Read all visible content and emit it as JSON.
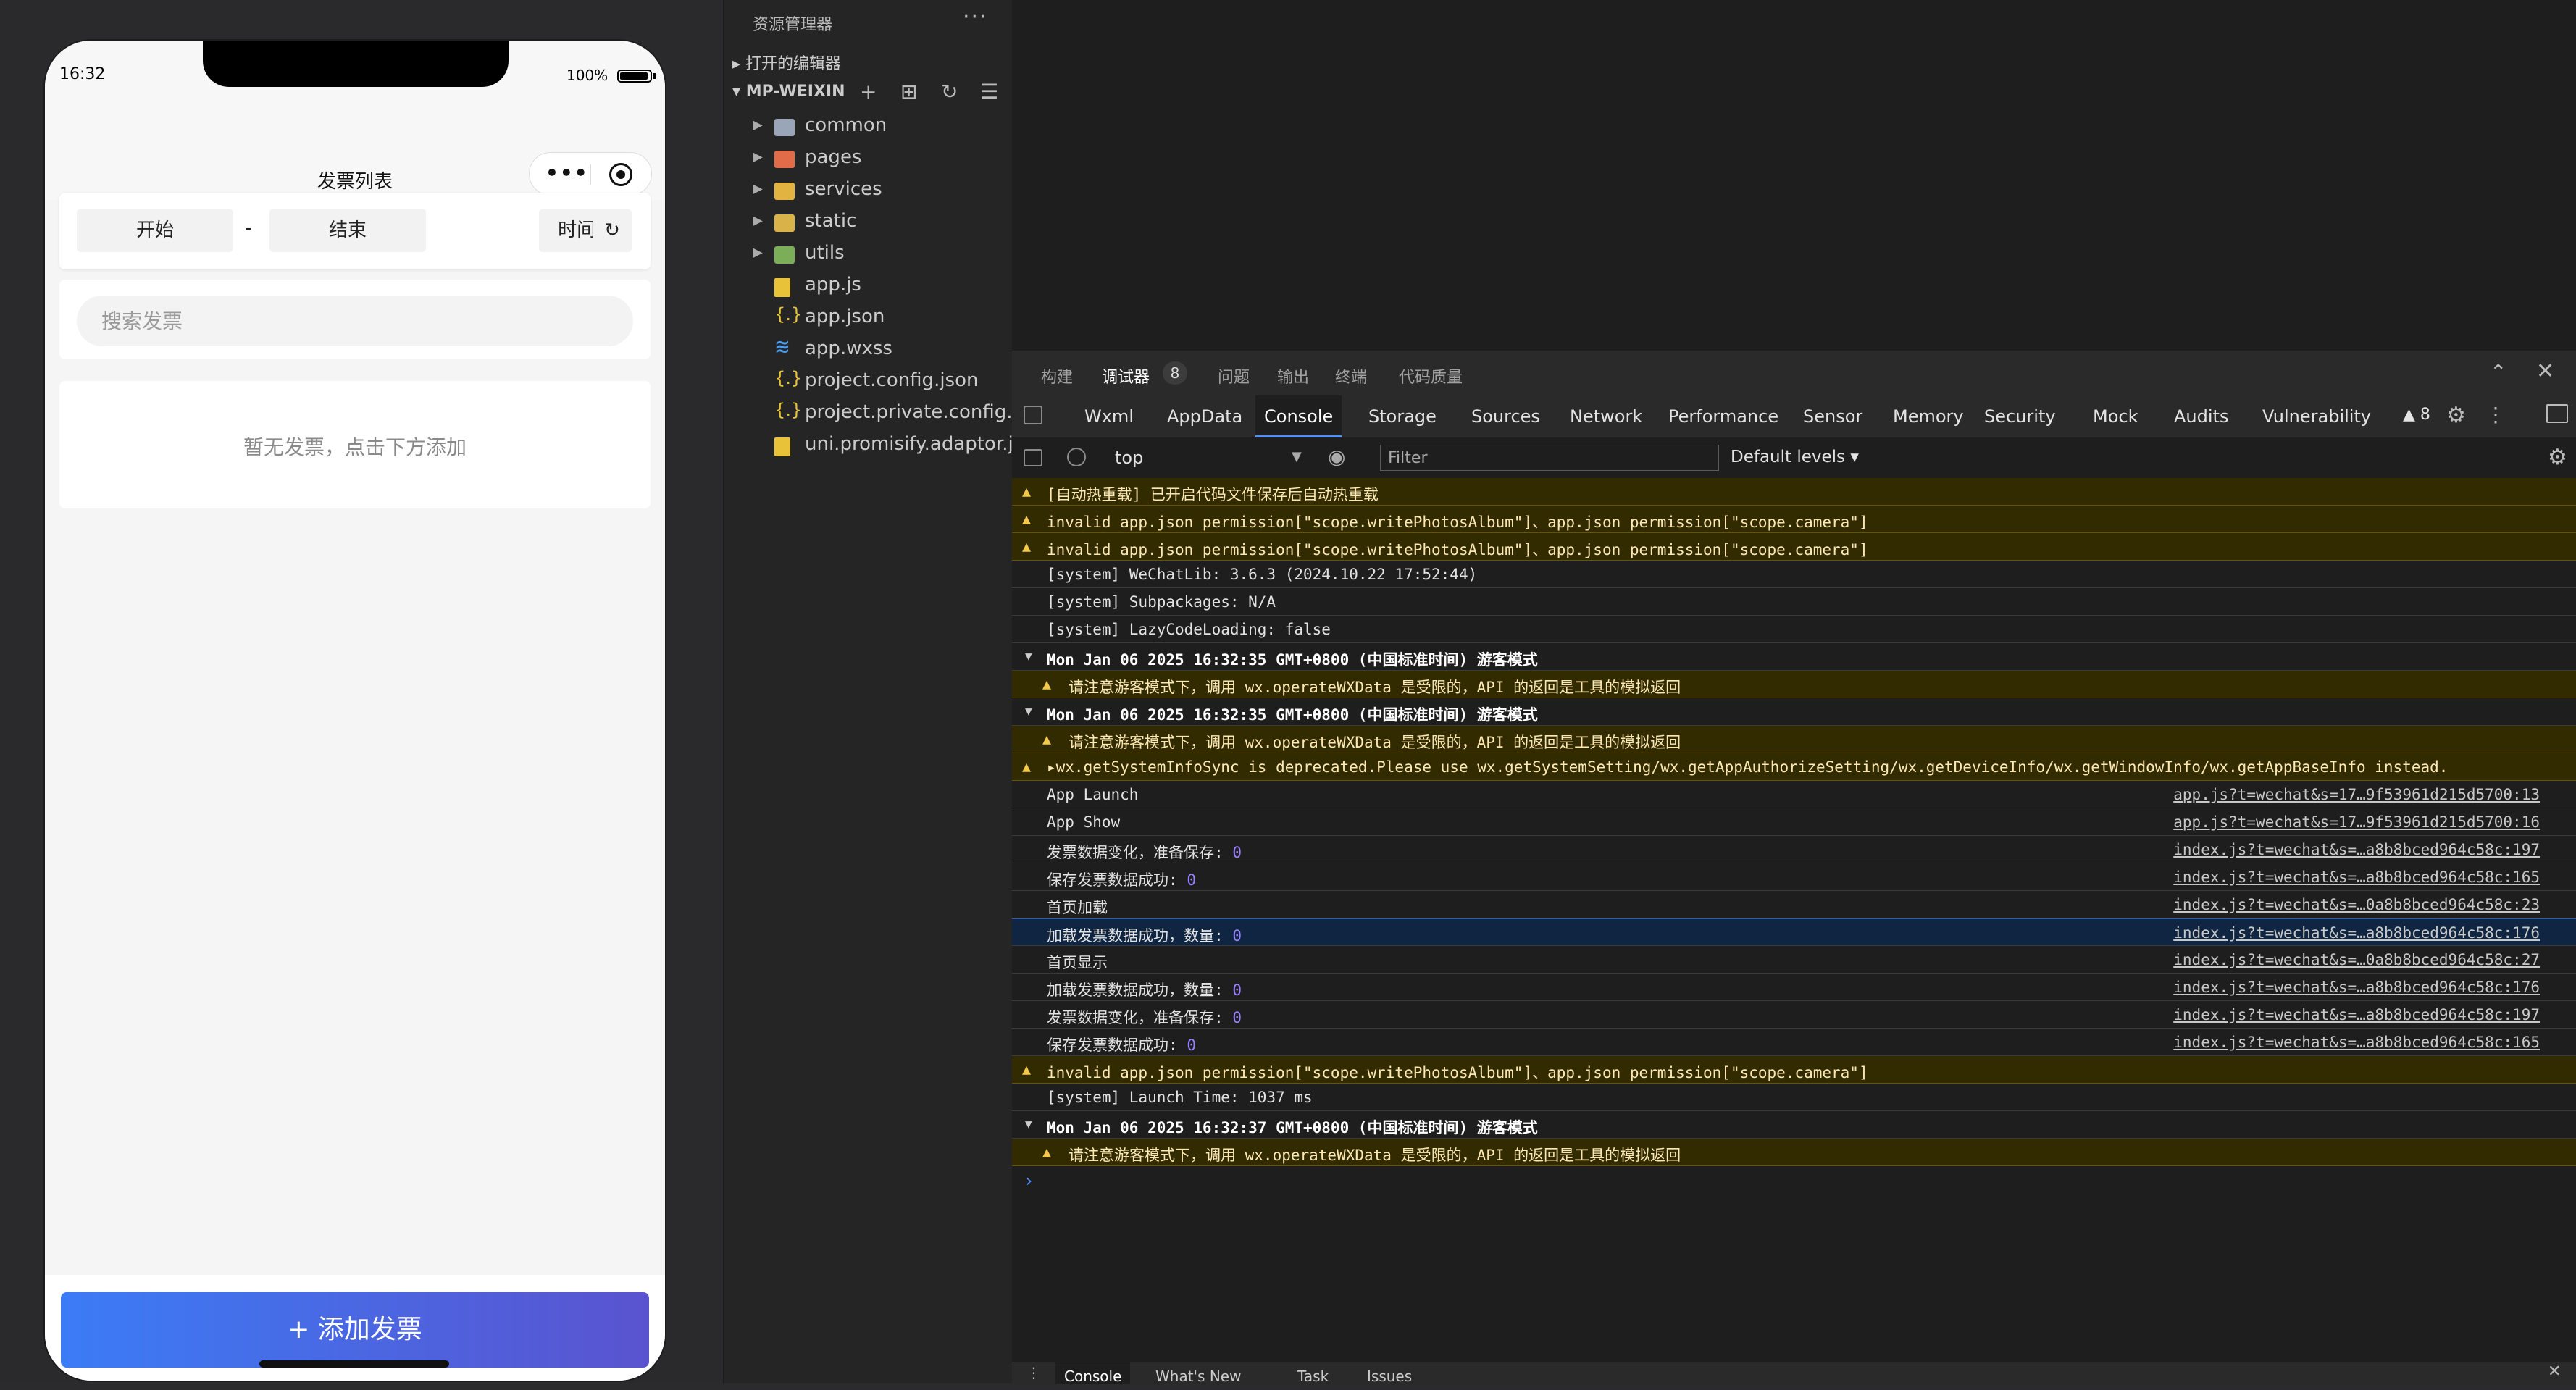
{
  "phone": {
    "status_time": "16:32",
    "battery_text": "100%",
    "nav_title": "发票列表",
    "capsule_more": "•••",
    "start_label": "开始",
    "date_separator": "-",
    "end_label": "结束",
    "sort_label": "时间↓",
    "reset_label": "↻",
    "search_placeholder": "搜索发票",
    "empty_text": "暂无发票，点击下方添加",
    "add_button": "+ 添加发票"
  },
  "explorer": {
    "title": "资源管理器",
    "more": "···",
    "open_editors": "▸ 打开的编辑器",
    "project": "▾ MP-WEIXIN",
    "tools": [
      "+",
      "⊞",
      "↻",
      "☰"
    ],
    "items": [
      {
        "label": "common",
        "type": "folder",
        "icon": "folder-icon"
      },
      {
        "label": "pages",
        "type": "folder",
        "icon": "folder-pages-icon"
      },
      {
        "label": "services",
        "type": "folder",
        "icon": "folder-services-icon"
      },
      {
        "label": "static",
        "type": "folder",
        "icon": "folder-static-icon"
      },
      {
        "label": "utils",
        "type": "folder",
        "icon": "folder-utils-icon"
      },
      {
        "label": "app.js",
        "type": "js",
        "icon": "js-file-icon"
      },
      {
        "label": "app.json",
        "type": "json",
        "icon": "json-file-icon"
      },
      {
        "label": "app.wxss",
        "type": "wxss",
        "icon": "wxss-file-icon"
      },
      {
        "label": "project.config.json",
        "type": "json",
        "icon": "json-file-icon"
      },
      {
        "label": "project.private.config...",
        "type": "json",
        "icon": "json-file-icon"
      },
      {
        "label": "uni.promisify.adaptor.js",
        "type": "js",
        "icon": "js-file-icon"
      }
    ]
  },
  "devtools": {
    "top_tabs": [
      "构建",
      "调试器",
      "问题",
      "输出",
      "终端",
      "代码质量"
    ],
    "debug_badge": "8",
    "panel_tabs": [
      "Wxml",
      "AppData",
      "Console",
      "Storage",
      "Sources",
      "Network",
      "Performance",
      "Sensor",
      "Memory",
      "Security",
      "Mock",
      "Audits",
      "Vulnerability"
    ],
    "warning_count": "▲ 8",
    "context": "top",
    "filter_placeholder": "Filter",
    "levels": "Default levels ▾",
    "drawer_tabs": [
      "Console",
      "What's New",
      "Task",
      "Issues"
    ],
    "prompt": "›"
  },
  "console_rows": [
    {
      "kind": "warn",
      "text": "[自动热重载] 已开启代码文件保存后自动热重载",
      "src": ""
    },
    {
      "kind": "warn",
      "text": "invalid app.json permission[\"scope.writePhotosAlbum\"]、app.json permission[\"scope.camera\"]",
      "src": ""
    },
    {
      "kind": "warn",
      "text": "invalid app.json permission[\"scope.writePhotosAlbum\"]、app.json permission[\"scope.camera\"]",
      "src": ""
    },
    {
      "kind": "log",
      "text": "[system] WeChatLib: 3.6.3 (2024.10.22 17:52:44)",
      "src": ""
    },
    {
      "kind": "log",
      "text": "[system] Subpackages: N/A",
      "src": ""
    },
    {
      "kind": "log",
      "text": "[system] LazyCodeLoading: false",
      "src": ""
    },
    {
      "kind": "group",
      "text": "Mon Jan 06 2025 16:32:35 GMT+0800 (中国标准时间) 游客模式",
      "src": ""
    },
    {
      "kind": "group-warn",
      "text": "请注意游客模式下，调用 wx.operateWXData 是受限的，API 的返回是工具的模拟返回",
      "src": ""
    },
    {
      "kind": "group",
      "text": "Mon Jan 06 2025 16:32:35 GMT+0800 (中国标准时间) 游客模式",
      "src": ""
    },
    {
      "kind": "group-warn",
      "text": "请注意游客模式下，调用 wx.operateWXData 是受限的，API 的返回是工具的模拟返回",
      "src": ""
    },
    {
      "kind": "warn",
      "text": "▸wx.getSystemInfoSync is deprecated.Please use wx.getSystemSetting/wx.getAppAuthorizeSetting/wx.getDeviceInfo/wx.getWindowInfo/wx.getAppBaseInfo instead.",
      "src": ""
    },
    {
      "kind": "log",
      "text": "App Launch",
      "src": "app.js?t=wechat&s=17…9f53961d215d5700:13"
    },
    {
      "kind": "log",
      "text": "App Show",
      "src": "app.js?t=wechat&s=17…9f53961d215d5700:16"
    },
    {
      "kind": "log",
      "text": "发票数据变化，准备保存:",
      "num": "0",
      "src": "index.js?t=wechat&s=…a8b8bced964c58c:197"
    },
    {
      "kind": "log",
      "text": "保存发票数据成功:",
      "num": "0",
      "src": "index.js?t=wechat&s=…a8b8bced964c58c:165"
    },
    {
      "kind": "log",
      "text": "首页加载",
      "src": "index.js?t=wechat&s=…0a8b8bced964c58c:23"
    },
    {
      "kind": "selected",
      "text": "加载发票数据成功，数量:",
      "num": "0",
      "src": "index.js?t=wechat&s=…a8b8bced964c58c:176"
    },
    {
      "kind": "log",
      "text": "首页显示",
      "src": "index.js?t=wechat&s=…0a8b8bced964c58c:27"
    },
    {
      "kind": "log",
      "text": "加载发票数据成功，数量:",
      "num": "0",
      "src": "index.js?t=wechat&s=…a8b8bced964c58c:176"
    },
    {
      "kind": "log",
      "text": "发票数据变化，准备保存:",
      "num": "0",
      "src": "index.js?t=wechat&s=…a8b8bced964c58c:197"
    },
    {
      "kind": "log",
      "text": "保存发票数据成功:",
      "num": "0",
      "src": "index.js?t=wechat&s=…a8b8bced964c58c:165"
    },
    {
      "kind": "warn",
      "text": "invalid app.json permission[\"scope.writePhotosAlbum\"]、app.json permission[\"scope.camera\"]",
      "src": ""
    },
    {
      "kind": "log",
      "text": "[system] Launch Time: 1037 ms",
      "src": ""
    },
    {
      "kind": "group",
      "text": "Mon Jan 06 2025 16:32:37 GMT+0800 (中国标准时间) 游客模式",
      "src": ""
    },
    {
      "kind": "group-warn",
      "text": "请注意游客模式下，调用 wx.operateWXData 是受限的，API 的返回是工具的模拟返回",
      "src": ""
    }
  ]
}
